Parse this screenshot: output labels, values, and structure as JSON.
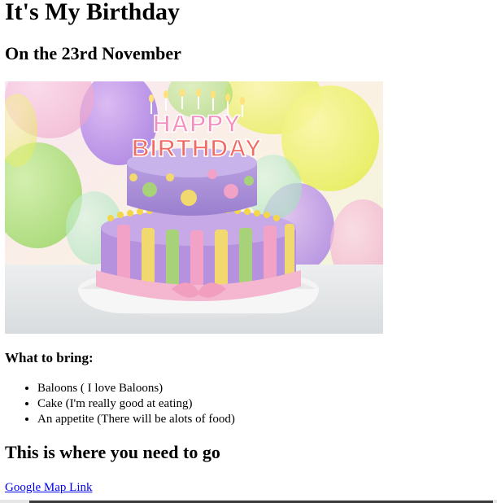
{
  "page": {
    "title": "It's My Birthday",
    "subtitle": "On the 23rd November",
    "image": {
      "alt": "Birthday cake",
      "topper_line1": "HAPPY",
      "topper_line2": "BIRTHDAY"
    },
    "bring_heading": "What to bring:",
    "bring_items": [
      "Baloons ( I love Baloons)",
      "Cake (I'm really good at eating)",
      "An appetite (There will be alots of food)"
    ],
    "directions_heading": "This is where you need to go",
    "map_link_label": "Google Map Link"
  },
  "colors": {
    "link": "#0000ee",
    "text": "#000000",
    "background": "#ffffff"
  }
}
